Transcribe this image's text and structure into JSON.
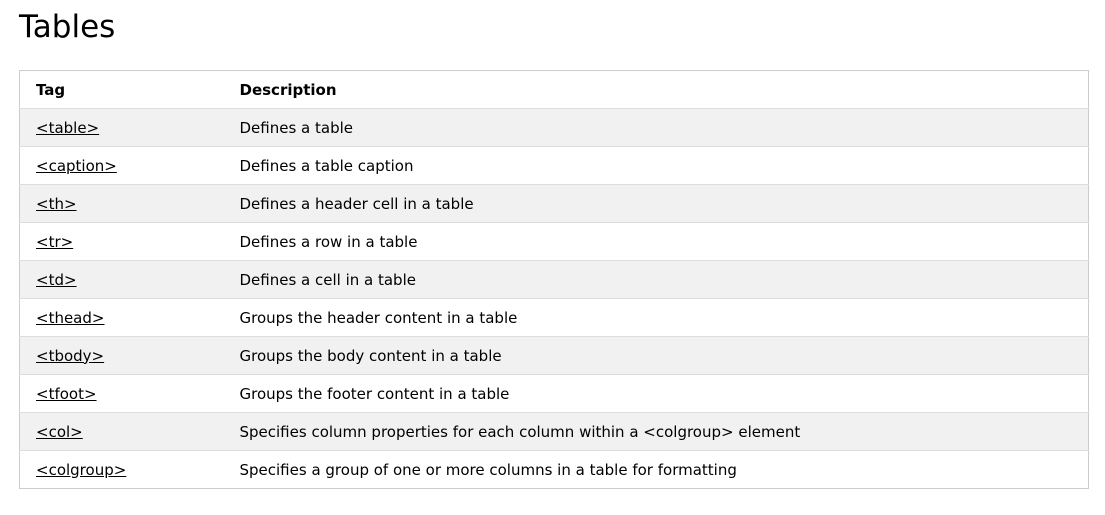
{
  "page": {
    "title": "Tables"
  },
  "table": {
    "headers": {
      "tag": "Tag",
      "description": "Description"
    },
    "rows": [
      {
        "tag": "<table>",
        "description": "Defines a table"
      },
      {
        "tag": "<caption>",
        "description": "Defines a table caption"
      },
      {
        "tag": "<th>",
        "description": "Defines a header cell in a table"
      },
      {
        "tag": "<tr>",
        "description": "Defines a row in a table"
      },
      {
        "tag": "<td>",
        "description": "Defines a cell in a table"
      },
      {
        "tag": "<thead>",
        "description": "Groups the header content in a table"
      },
      {
        "tag": "<tbody>",
        "description": "Groups the body content in a table"
      },
      {
        "tag": "<tfoot>",
        "description": "Groups the footer content in a table"
      },
      {
        "tag": "<col>",
        "description": "Specifies column properties for each column within a <colgroup> element"
      },
      {
        "tag": "<colgroup>",
        "description": "Specifies a group of one or more columns in a table for formatting"
      }
    ]
  },
  "colors": {
    "stripe": "#f1f1f1",
    "border": "#cccccc",
    "text": "#000000"
  }
}
